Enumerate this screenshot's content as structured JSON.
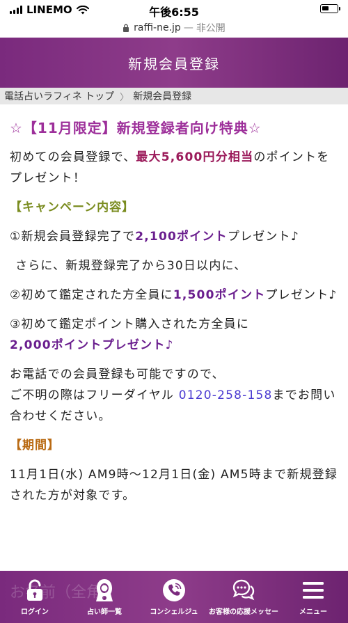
{
  "status_bar": {
    "carrier": "LINEMO",
    "time": "午後6:55"
  },
  "url_bar": {
    "domain": "raffi-ne.jp",
    "separator": "—",
    "note": "非公開"
  },
  "header": {
    "title": "新規会員登録"
  },
  "breadcrumb": {
    "home": "電話占いラフィネ トップ",
    "separator": "〉",
    "current": "新規会員登録"
  },
  "content": {
    "promo_title": "☆【11月限定】新規登録者向け特典☆",
    "intro_pre": "初めての会員登録で、",
    "intro_highlight": "最大5,600円分相当",
    "intro_post": "のポイントをプレゼント！",
    "campaign_head": "【キャンペーン内容】",
    "item1_pre": "①新規会員登録完了で",
    "item1_highlight": "2,100ポイント",
    "item1_post": "プレゼント♪",
    "item_note": "さらに、新規登録完了から30日以内に、",
    "item2_pre": "②初めて鑑定された方全員に",
    "item2_highlight": "1,500ポイント",
    "item2_post": "プレゼント♪",
    "item3_pre": "③初めて鑑定ポイント購入された方全員に",
    "item3_highlight": "2,000ポイントプレゼント♪",
    "phone_pre_line1": "お電話での会員登録も可能ですので、",
    "phone_pre_line2": "ご不明の際はフリーダイヤル",
    "phone_number": "0120-258-158",
    "phone_post": "までお問い合わせください。",
    "period_head": "【期間】",
    "period_text": "11月1日(水) AM9時〜12月1日(金) AM5時まで新規登録された方が対象です。",
    "ghost_text": "お名前（全角）"
  },
  "bottom_nav": {
    "items": [
      {
        "label": "ログイン",
        "icon": "lock-icon"
      },
      {
        "label": "占い師一覧",
        "icon": "fortune-teller-icon"
      },
      {
        "label": "コンシェルジュ",
        "icon": "phone-icon"
      },
      {
        "label": "お客様の応援メッセージ",
        "icon": "chat-bubble-icon"
      },
      {
        "label": "メニュー",
        "icon": "hamburger-menu-icon"
      }
    ]
  },
  "colors": {
    "brand_purple": "#7a2a7d",
    "title_pink": "#9d2f9a",
    "highlight_red": "#9b1a5a",
    "highlight_purple": "#6a1e8e",
    "section_olive": "#7a8c1f",
    "section_orange": "#b96a13",
    "link_blue": "#4a3ad1"
  }
}
